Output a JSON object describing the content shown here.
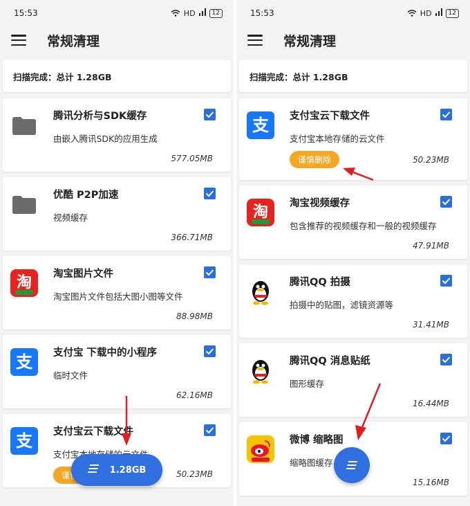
{
  "left": {
    "status": {
      "time": "15:53",
      "network": "HD",
      "battery": "12"
    },
    "appbar": {
      "title": "常规清理"
    },
    "summary": "扫描完成：总计 1.28GB",
    "items": [
      {
        "title": "腾讯分析与SDK缓存",
        "desc": "由嵌入腾讯SDK的应用生成",
        "size": "577.05MB",
        "icon": "folder-icon"
      },
      {
        "title": "优酷 P2P加速",
        "desc": "视频缓存",
        "size": "366.71MB",
        "icon": "folder-icon"
      },
      {
        "title": "淘宝图片文件",
        "desc": "淘宝图片文件包括大图小图等文件",
        "size": "88.98MB",
        "icon": "taobao-icon"
      },
      {
        "title": "支付宝 下载中的小程序",
        "desc": "临时文件",
        "size": "62.16MB",
        "icon": "alipay-icon"
      },
      {
        "title": "支付宝云下载文件",
        "desc": "支付宝本地存储的云文件",
        "size": "50.23MB",
        "icon": "alipay-icon",
        "button": "谨慎删除"
      }
    ],
    "fab": {
      "label": "1.28GB",
      "icon": "clean-list-icon"
    }
  },
  "right": {
    "status": {
      "time": "15:53",
      "network": "HD",
      "battery": "12"
    },
    "appbar": {
      "title": "常规清理"
    },
    "summary": "扫描完成：总计 1.28GB",
    "items": [
      {
        "title": "支付宝云下载文件",
        "desc": "支付宝本地存储的云文件",
        "size": "50.23MB",
        "icon": "alipay-icon",
        "button": "谨慎删除"
      },
      {
        "title": "淘宝视频缓存",
        "desc": "包含推荐的视频缓存和一般的视频缓存",
        "size": "47.91MB",
        "icon": "taobao-icon"
      },
      {
        "title": "腾讯QQ 拍摄",
        "desc": "拍摄中的贴图，滤镜资源等",
        "size": "31.41MB",
        "icon": "qq-icon"
      },
      {
        "title": "腾讯QQ 消息贴纸",
        "desc": "图形缓存",
        "size": "16.44MB",
        "icon": "qq-icon"
      },
      {
        "title": "微博 缩略图",
        "desc": "缩略图缓存",
        "size": "15.16MB",
        "icon": "weibo-icon"
      }
    ],
    "fab": {
      "icon": "clean-list-icon"
    }
  },
  "colors": {
    "accent": "#2f6fe0",
    "checkbox": "#2b6fdb",
    "warning": "#f5a623",
    "annotation": "#e02020"
  }
}
